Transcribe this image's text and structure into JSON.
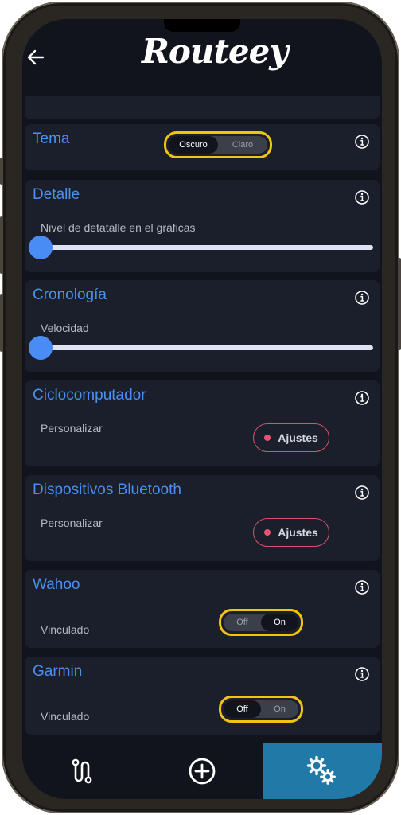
{
  "app": {
    "logo_text": "Routeey"
  },
  "header": {
    "back_icon": "arrow-left-icon"
  },
  "settings": {
    "tema": {
      "title": "Tema",
      "options": [
        "Oscuro",
        "Claro"
      ],
      "selected": "Oscuro"
    },
    "detalle": {
      "title": "Detalle",
      "subtitle": "Nivel de detatalle en el gráficas",
      "slider_value": 0
    },
    "cronologia": {
      "title": "Cronología",
      "subtitle": "Velocidad",
      "slider_value": 0
    },
    "ciclocomputador": {
      "title": "Ciclocomputador",
      "subtitle": "Personalizar",
      "button_label": "Ajustes"
    },
    "bluetooth": {
      "title": "Dispositivos Bluetooth",
      "subtitle": "Personalizar",
      "button_label": "Ajustes"
    },
    "wahoo": {
      "title": "Wahoo",
      "subtitle": "Vinculado",
      "options": [
        "Off",
        "On"
      ],
      "selected": "On"
    },
    "garmin": {
      "title": "Garmin",
      "subtitle": "Vinculado",
      "options": [
        "Off",
        "On"
      ],
      "selected": "Off"
    }
  },
  "tabbar": {
    "items": [
      {
        "icon": "route-icon",
        "active": false
      },
      {
        "icon": "add-circle-icon",
        "active": false
      },
      {
        "icon": "gears-icon",
        "active": true
      }
    ]
  },
  "colors": {
    "background": "#11141d",
    "card": "#1b1f2c",
    "accent_blue": "#4a90f0",
    "toggle_highlight": "#f1c40f",
    "button_outline": "#d9526a",
    "active_tab": "#2079a6"
  }
}
